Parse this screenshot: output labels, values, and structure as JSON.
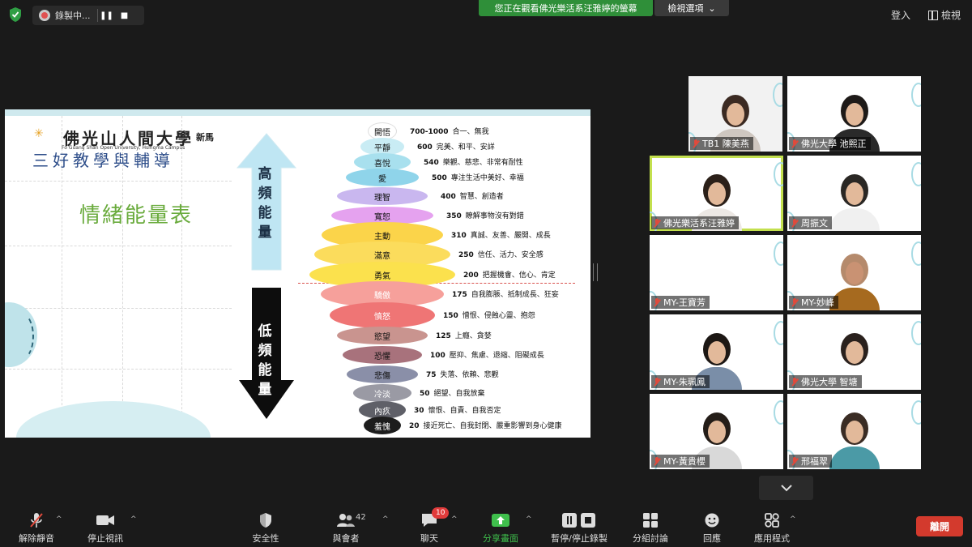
{
  "topbar": {
    "recording_label": "錄製中...",
    "viewing_banner": "您正在觀看佛光樂活系汪雅婷的螢幕",
    "view_options": "檢視選項",
    "login": "登入",
    "view": "檢視"
  },
  "slide": {
    "university_title": "佛光山人間大學",
    "university_location": "新馬",
    "university_english": "Fo Guang Shan Open University, Hsingma Campus",
    "course_title": "三好教學與輔導",
    "chart_title": "情緒能量表",
    "high_label": "高頻能量",
    "low_label": "低頻能量",
    "levels": [
      {
        "name": "開悟",
        "value": "700-1000",
        "desc": "合一、無我",
        "color": "#ffffff"
      },
      {
        "name": "平靜",
        "value": "600",
        "desc": "完美、和平、安詳",
        "color": "#c9ecf4"
      },
      {
        "name": "喜悅",
        "value": "540",
        "desc": "樂觀、慈悲、非常有耐性",
        "color": "#a8e0ee"
      },
      {
        "name": "愛",
        "value": "500",
        "desc": "專注生活中美好、幸福",
        "color": "#8fd4ea"
      },
      {
        "name": "理智",
        "value": "400",
        "desc": "智慧、創造者",
        "color": "#c9b7ef"
      },
      {
        "name": "寬恕",
        "value": "350",
        "desc": "瞭解事物沒有對錯",
        "color": "#e5a2ef"
      },
      {
        "name": "主動",
        "value": "310",
        "desc": "真誠、友善、嚴開、成長",
        "color": "#fbd44a"
      },
      {
        "name": "滿意",
        "value": "250",
        "desc": "信任、活力、安全感",
        "color": "#fbdc5c"
      },
      {
        "name": "勇氣",
        "value": "200",
        "desc": "把握機會、信心、肯定",
        "color": "#fbe14d"
      },
      {
        "name": "驕傲",
        "value": "175",
        "desc": "自我膨脹、抵制成長、狂妄",
        "color": "#f6a09b"
      },
      {
        "name": "憤怒",
        "value": "150",
        "desc": "憎恨、侵蝕心靈、抱怨",
        "color": "#ef7575"
      },
      {
        "name": "慾望",
        "value": "125",
        "desc": "上癮、貪婪",
        "color": "#c9948f"
      },
      {
        "name": "恐懼",
        "value": "100",
        "desc": "壓抑、焦慮、退縮、阻礙成長",
        "color": "#a8727c"
      },
      {
        "name": "悲傷",
        "value": "75",
        "desc": "失落、依賴、悲觀",
        "color": "#8a8fa8"
      },
      {
        "name": "冷淡",
        "value": "50",
        "desc": "絕望、自我放棄",
        "color": "#9a9aa4"
      },
      {
        "name": "內疚",
        "value": "30",
        "desc": "懷恨、自責、自我否定",
        "color": "#5f6068"
      },
      {
        "name": "羞愧",
        "value": "20",
        "desc": "接近死亡、自我封閉、嚴重影響到身心健康",
        "color": "#1d1d1d"
      }
    ]
  },
  "participants": [
    {
      "name": "TB1 陳美燕"
    },
    {
      "name": "佛光大學 池熙正"
    },
    {
      "name": "佛光樂活系汪雅婷"
    },
    {
      "name": "周振文"
    },
    {
      "name": "MY-王寶芳"
    },
    {
      "name": "MY-妙峰"
    },
    {
      "name": "MY-朱珮鳳"
    },
    {
      "name": "佛光大學 智塘"
    },
    {
      "name": "MY-黃貴櫻"
    },
    {
      "name": "邢福翠"
    }
  ],
  "toolbar": {
    "unmute": "解除靜音",
    "stop_video": "停止視訊",
    "security": "安全性",
    "participants": "與會者",
    "participants_count": "42",
    "chat": "聊天",
    "chat_badge": "10",
    "share": "分享畫面",
    "pause_record": "暫停/停止錄製",
    "breakout": "分組討論",
    "reactions": "回應",
    "apps": "應用程式",
    "leave": "離開"
  }
}
